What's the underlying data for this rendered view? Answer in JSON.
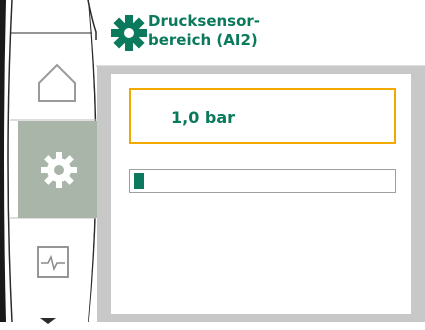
{
  "header": {
    "title_line1": "Drucksensor-",
    "title_line2": "bereich (AI2)",
    "title_icon": "gear-icon"
  },
  "sidebar": {
    "items": [
      {
        "icon": "home-icon"
      },
      {
        "icon": "gear-icon",
        "selected": true
      },
      {
        "icon": "diagnostics-icon"
      }
    ],
    "scroll_indicator": "chevron-down-icon"
  },
  "main": {
    "value": "1,0 bar",
    "progress_fraction": 0.03
  },
  "colors": {
    "accent": "#0b7a5c",
    "highlight": "#f2a900",
    "selected_bg": "#a9b5a9",
    "frame": "#2b2b2b"
  }
}
